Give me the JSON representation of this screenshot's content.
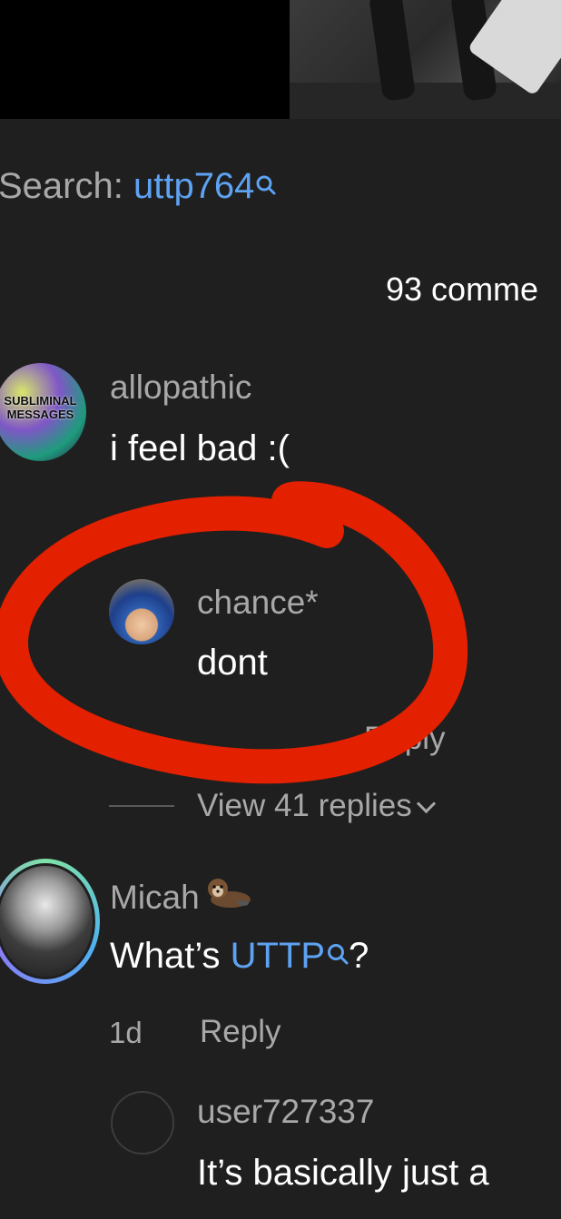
{
  "search": {
    "prefix": "Search: ",
    "term": "uttp764"
  },
  "comment_count": "93 comme",
  "comments": [
    {
      "username": "allopathic",
      "text": "i feel bad :(",
      "avatar_text": "SUBLIMINAL MESSAGES"
    },
    {
      "username": "chance*",
      "text": "dont",
      "reply_label": "Reply"
    },
    {
      "view_replies": "View 41 replies"
    },
    {
      "username": "Micah",
      "text_before": "What’s ",
      "text_link": "UTTP",
      "text_after": "?",
      "time": "1d",
      "reply_label": "Reply"
    },
    {
      "username": "user727337",
      "text": "It’s basically just a"
    }
  ],
  "colors": {
    "background": "#1f1f1f",
    "link": "#5ea2f2",
    "muted": "#a8a8a8",
    "annotation": "#e32000"
  },
  "icons": [
    "search-icon",
    "chevron-down-icon",
    "otter-emoji-icon"
  ]
}
